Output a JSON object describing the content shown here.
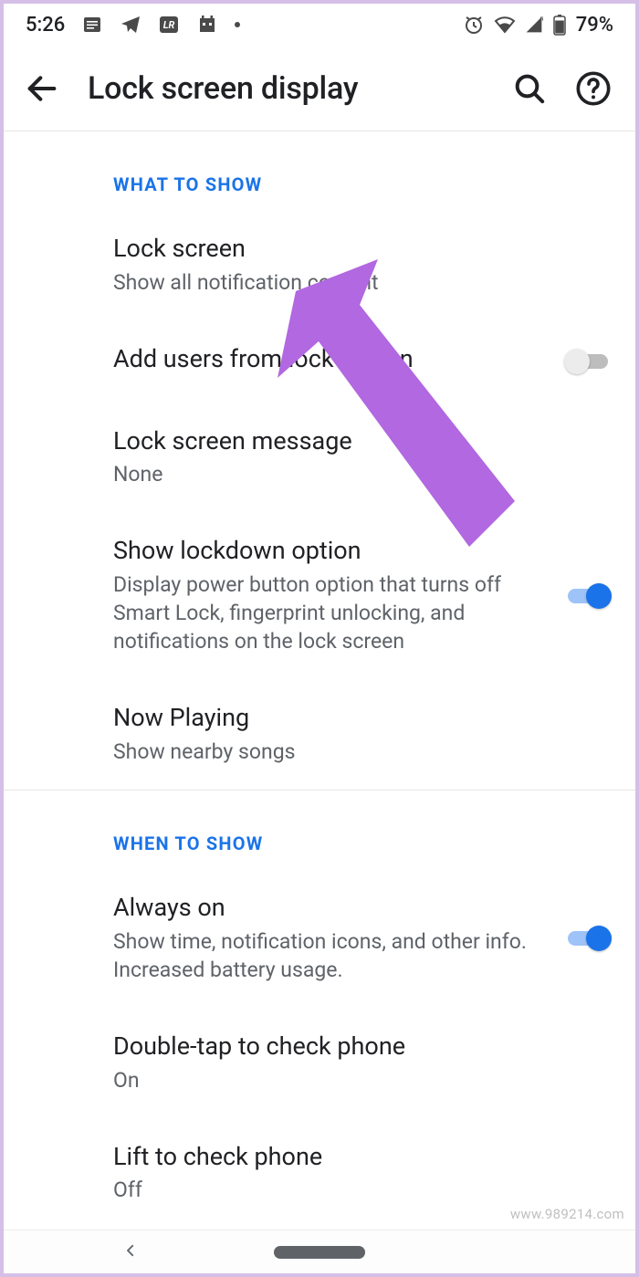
{
  "statusbar": {
    "time": "5:26",
    "battery": "79%"
  },
  "appbar": {
    "title": "Lock screen display"
  },
  "sections": {
    "what_header": "WHAT TO SHOW",
    "when_header": "WHEN TO SHOW"
  },
  "items": {
    "lock_screen": {
      "title": "Lock screen",
      "sub": "Show all notification content"
    },
    "add_users": {
      "title": "Add users from lock screen",
      "on": false
    },
    "lock_message": {
      "title": "Lock screen message",
      "sub": "None"
    },
    "lockdown": {
      "title": "Show lockdown option",
      "sub": "Display power button option that turns off Smart Lock, fingerprint unlocking, and notifications on the lock screen",
      "on": true
    },
    "now_playing": {
      "title": "Now Playing",
      "sub": "Show nearby songs"
    },
    "always_on": {
      "title": "Always on",
      "sub": "Show time, notification icons, and other info. Increased battery usage.",
      "on": true
    },
    "double_tap": {
      "title": "Double-tap to check phone",
      "sub": "On"
    },
    "lift": {
      "title": "Lift to check phone",
      "sub": "Off"
    }
  },
  "watermark": "www.989214.com",
  "colors": {
    "accent": "#1a73e8",
    "arrow": "#b168e0"
  }
}
